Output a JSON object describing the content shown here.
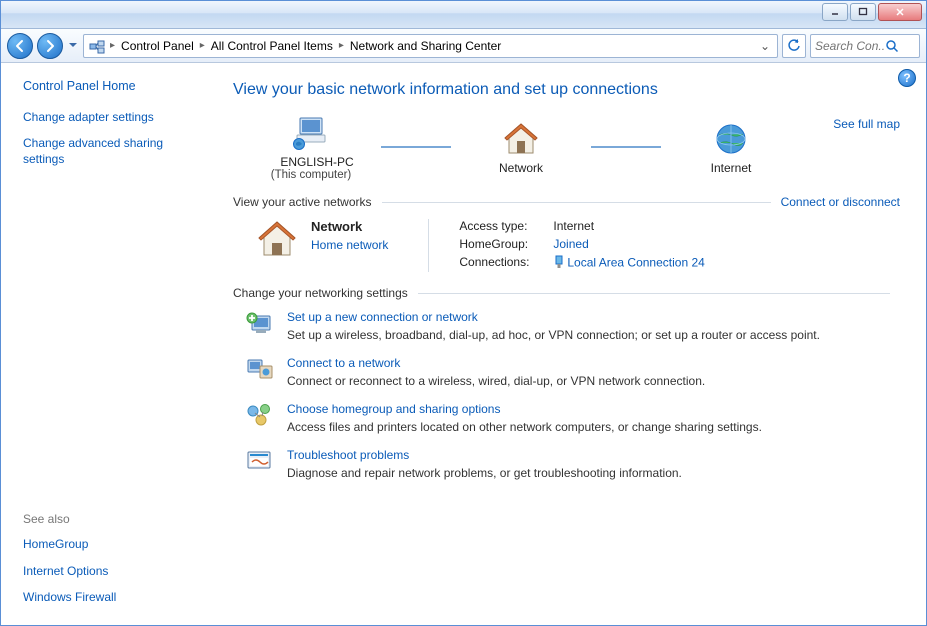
{
  "breadcrumb": {
    "items": [
      "Control Panel",
      "All Control Panel Items",
      "Network and Sharing Center"
    ]
  },
  "search": {
    "placeholder": "Search Con..."
  },
  "sidebar": {
    "home": "Control Panel Home",
    "links": [
      "Change adapter settings",
      "Change advanced sharing settings"
    ],
    "see_also_title": "See also",
    "see_also": [
      "HomeGroup",
      "Internet Options",
      "Windows Firewall"
    ]
  },
  "main": {
    "heading": "View your basic network information and set up connections",
    "full_map": "See full map",
    "nodes": {
      "pc": {
        "label": "ENGLISH-PC",
        "sub": "(This computer)"
      },
      "network": {
        "label": "Network"
      },
      "internet": {
        "label": "Internet"
      }
    },
    "active_title": "View your active networks",
    "connect_link": "Connect or disconnect",
    "active": {
      "name": "Network",
      "type": "Home network",
      "access_label": "Access type:",
      "access_value": "Internet",
      "homegroup_label": "HomeGroup:",
      "homegroup_value": "Joined",
      "conn_label": "Connections:",
      "conn_value": "Local Area Connection 24"
    },
    "change_title": "Change your networking settings",
    "items": [
      {
        "title": "Set up a new connection or network",
        "desc": "Set up a wireless, broadband, dial-up, ad hoc, or VPN connection; or set up a router or access point."
      },
      {
        "title": "Connect to a network",
        "desc": "Connect or reconnect to a wireless, wired, dial-up, or VPN network connection."
      },
      {
        "title": "Choose homegroup and sharing options",
        "desc": "Access files and printers located on other network computers, or change sharing settings."
      },
      {
        "title": "Troubleshoot problems",
        "desc": "Diagnose and repair network problems, or get troubleshooting information."
      }
    ]
  }
}
